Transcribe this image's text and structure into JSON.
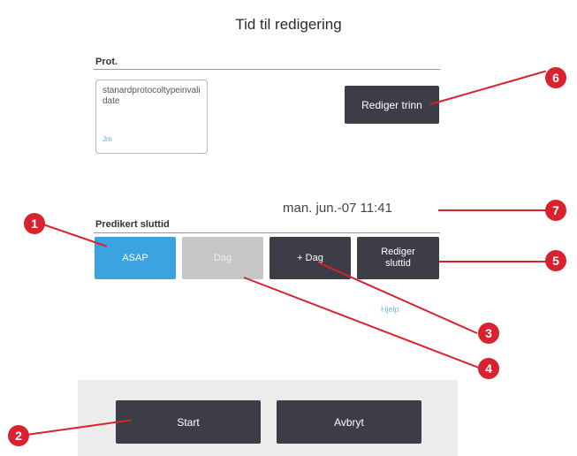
{
  "header": {
    "title": "Tid til redigering"
  },
  "protocol": {
    "label": "Prot.",
    "name": "stanardprotocoltypeinvalidate",
    "small_text": "Jm",
    "edit_steps_label": "Rediger trinn"
  },
  "endtime": {
    "label": "Predikert sluttid",
    "value": "man. jun.-07 11:41",
    "buttons": {
      "asap": "ASAP",
      "day": "Dag",
      "plus_day": "+ Dag",
      "edit_endtime": "Rediger sluttid"
    },
    "help_label": "Hjelp"
  },
  "footer": {
    "start_label": "Start",
    "cancel_label": "Avbryt"
  },
  "callouts": [
    "1",
    "2",
    "3",
    "4",
    "5",
    "6",
    "7"
  ],
  "colors": {
    "accent_blue": "#3aa3e0",
    "dark_button": "#3d3d47",
    "disabled_button": "#c6c6c9",
    "callout_red": "#d8222d"
  }
}
